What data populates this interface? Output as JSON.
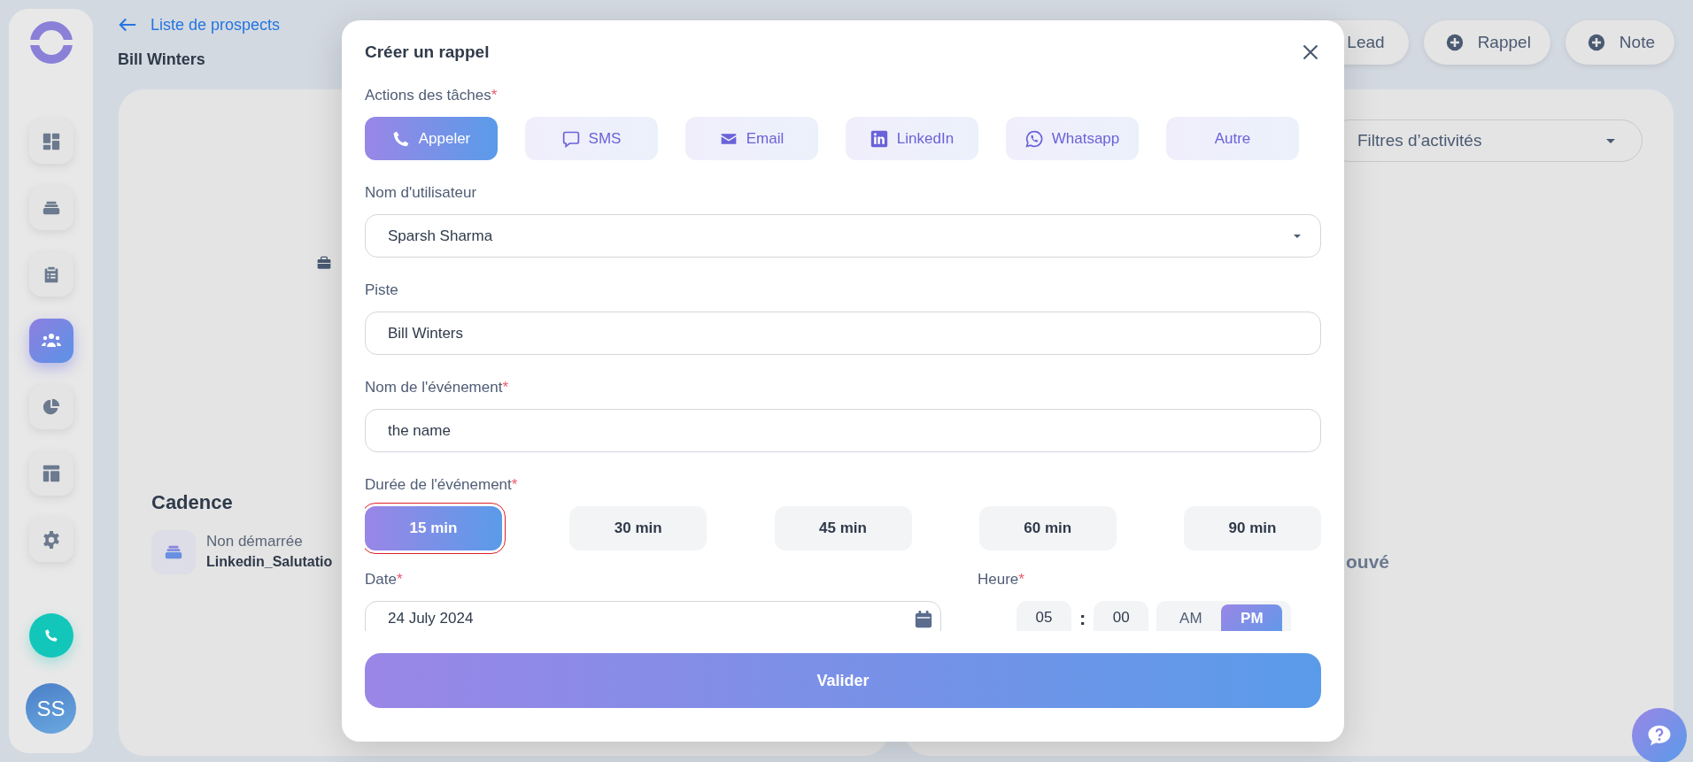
{
  "sidebar": {
    "items": [
      {
        "kind": "dashboard",
        "selected": false
      },
      {
        "kind": "stack",
        "selected": false
      },
      {
        "kind": "clipboard",
        "selected": false
      },
      {
        "kind": "people",
        "selected": true
      },
      {
        "kind": "chart",
        "selected": false
      },
      {
        "kind": "layout",
        "selected": false
      },
      {
        "kind": "settings",
        "selected": false
      }
    ],
    "avatar": "SS"
  },
  "header": {
    "back_link": "Liste de prospects",
    "title": "Bill Winters"
  },
  "top_buttons": [
    {
      "label": "Lead",
      "kind": "plain"
    },
    {
      "label": "Rappel",
      "kind": "add"
    },
    {
      "label": "Note",
      "kind": "add"
    }
  ],
  "activity_filter": {
    "value": "Filtres d’activités"
  },
  "cadence": {
    "title": "Cadence",
    "status": "Non démarrée",
    "name": "Linkedin_Salutatio"
  },
  "activity_panel": {
    "message_fragment": "ouvé"
  },
  "modal": {
    "title": "Créer un rappel",
    "actions": {
      "label": "Actions des tâches",
      "required_mark": "*",
      "options": [
        {
          "label": "Appeler",
          "kind": "call",
          "selected": true
        },
        {
          "label": "SMS",
          "kind": "sms",
          "selected": false
        },
        {
          "label": "Email",
          "kind": "email",
          "selected": false
        },
        {
          "label": "LinkedIn",
          "kind": "linkedin",
          "selected": false
        },
        {
          "label": "Whatsapp",
          "kind": "whatsapp",
          "selected": false
        },
        {
          "label": "Autre",
          "kind": "other",
          "selected": false
        }
      ]
    },
    "user": {
      "label": "Nom d'utilisateur",
      "value": "Sparsh Sharma"
    },
    "lead": {
      "label": "Piste",
      "value": "Bill Winters"
    },
    "event_name": {
      "label": "Nom de l'événement",
      "required_mark": "*",
      "value": "the name"
    },
    "duration": {
      "label": "Durée de l'événement",
      "required_mark": "*",
      "options": [
        {
          "label": "15 min",
          "selected": true,
          "focused": true
        },
        {
          "label": "30 min",
          "selected": false,
          "focused": false
        },
        {
          "label": "45 min",
          "selected": false,
          "focused": false
        },
        {
          "label": "60 min",
          "selected": false,
          "focused": false
        },
        {
          "label": "90 min",
          "selected": false,
          "focused": false
        }
      ]
    },
    "date": {
      "label": "Date",
      "required_mark": "*",
      "value": "24 July 2024"
    },
    "time": {
      "label": "Heure",
      "required_mark": "*",
      "hour": "05",
      "separator": ":",
      "minute": "00",
      "periods": [
        {
          "label": "AM",
          "selected": false
        },
        {
          "label": "PM",
          "selected": true
        }
      ]
    },
    "submit": "Valider"
  }
}
